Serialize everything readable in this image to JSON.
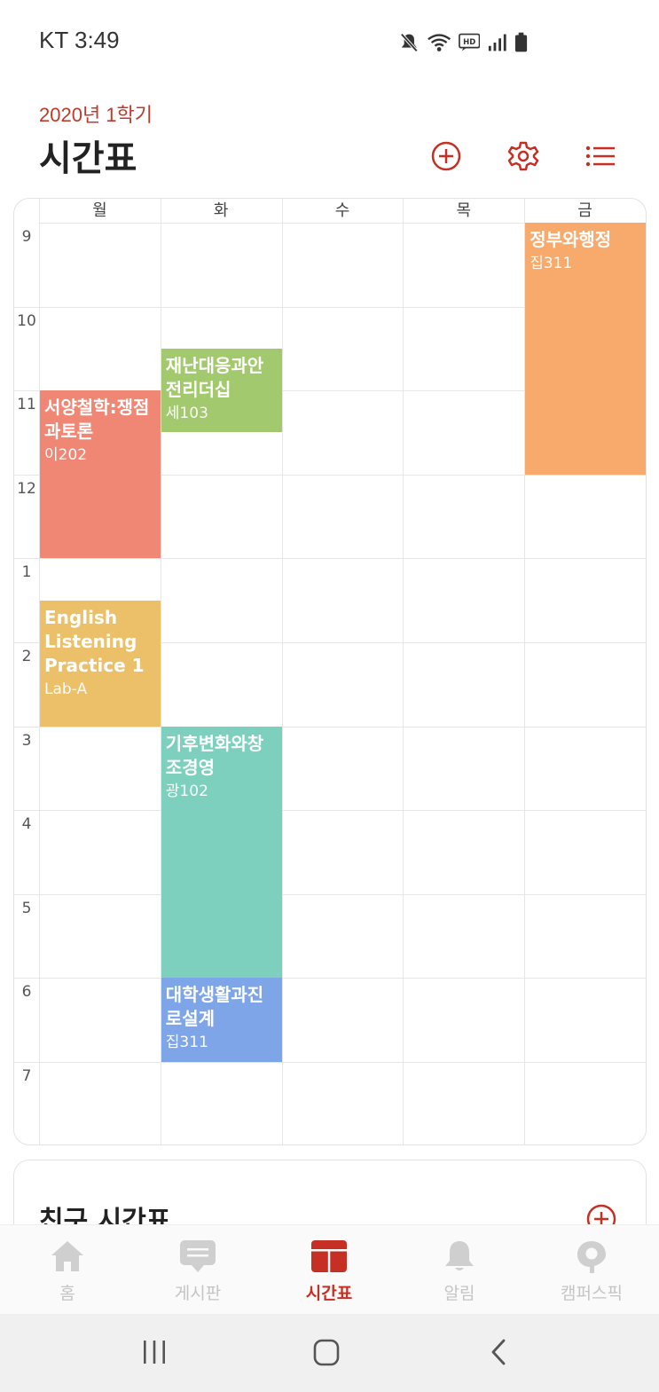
{
  "status_bar": {
    "carrier_time": "KT 3:49"
  },
  "header": {
    "semester": "2020년 1학기",
    "title": "시간표",
    "icons": [
      "add-circle-icon",
      "gear-icon",
      "list-icon"
    ],
    "accent_color": "#c62f23"
  },
  "timetable": {
    "days": [
      "월",
      "화",
      "수",
      "목",
      "금"
    ],
    "hours": [
      "9",
      "10",
      "11",
      "12",
      "1",
      "2",
      "3",
      "4",
      "5",
      "6",
      "7"
    ],
    "courses": [
      {
        "name": "서양철학:쟁점과토론",
        "room": "이202",
        "day": 0,
        "start": 11.0,
        "end": 13.0,
        "color": "#f08674"
      },
      {
        "name": "English Listening Practice 1",
        "room": "Lab-A",
        "day": 0,
        "start": 13.5,
        "end": 15.0,
        "color": "#ecc068"
      },
      {
        "name": "재난대응과안전리더십",
        "room": "세103",
        "day": 1,
        "start": 10.5,
        "end": 11.5,
        "color": "#a3c96e"
      },
      {
        "name": "기후변화와창조경영",
        "room": "광102",
        "day": 1,
        "start": 15.0,
        "end": 18.0,
        "color": "#7dd0bd"
      },
      {
        "name": "대학생활과진로설계",
        "room": "집311",
        "day": 1,
        "start": 18.0,
        "end": 19.0,
        "color": "#7ea5e8"
      },
      {
        "name": "정부와행정",
        "room": "집311",
        "day": 4,
        "start": 9.0,
        "end": 12.0,
        "color": "#f8aa6c"
      }
    ]
  },
  "friends": {
    "title": "친구 시간표"
  },
  "bottom_nav": {
    "items": [
      {
        "label": "홈",
        "icon": "home-icon"
      },
      {
        "label": "게시판",
        "icon": "chat-bubble-icon"
      },
      {
        "label": "시간표",
        "icon": "timetable-icon",
        "active": true
      },
      {
        "label": "알림",
        "icon": "bell-icon"
      },
      {
        "label": "캠퍼스픽",
        "icon": "campuspick-icon"
      }
    ]
  },
  "system_nav": {
    "icons": [
      "recents-icon",
      "home-circle-icon",
      "back-icon"
    ]
  }
}
